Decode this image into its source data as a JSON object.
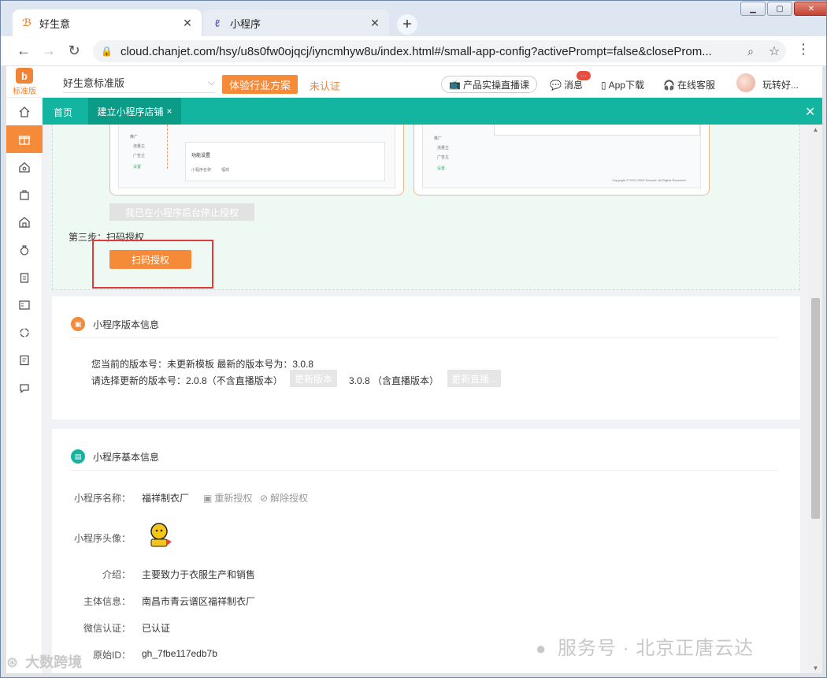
{
  "browser": {
    "tabs": [
      {
        "title": "好生意",
        "icon": "haoshengyi-logo-icon"
      },
      {
        "title": "小程序",
        "icon": "miniprogram-icon"
      }
    ],
    "url": "cloud.chanjet.com/hsy/u8s0fw0ojqcj/iyncmhyw8u/index.html#/small-app-config?activePrompt=false&closeProm...",
    "window_buttons": [
      "minimize",
      "maximize",
      "close"
    ]
  },
  "app": {
    "logo_edition": "标准版",
    "version_select": "好生意标准版",
    "plan_button": "体验行业方案",
    "unverified": "未认证",
    "live_course": "产品实操直播课",
    "messages": "消息",
    "message_badge": "···",
    "app_download": "App下载",
    "online_service": "在线客服",
    "username": "玩转好...",
    "tabs": {
      "home": "首页",
      "active": "建立小程序店铺",
      "active_close": "×"
    },
    "accent": "#13b4a0",
    "brand": "#f58a38"
  },
  "sidebar": {
    "items": [
      "home-icon",
      "gift-icon",
      "house-settings-icon",
      "bag-icon",
      "store-icon",
      "money-bag-icon",
      "clipboard-icon",
      "report-icon",
      "cycle-icon",
      "document-icon",
      "chat-icon"
    ]
  },
  "auth": {
    "stop_button": "我已在小程序后台停止授权",
    "step3_label": "第三步：扫码授权",
    "scan_button": "扫码授权",
    "mock_texts": {
      "menu_a": "推广",
      "menu_b": "流量主",
      "menu_c": "广告主",
      "menu_d": "设置",
      "section": "功能设置",
      "row": "小程序名称",
      "row2": "福祥",
      "footer": "Copyright © 2012-2020 Tencent. All Rights Reserved."
    }
  },
  "version_info": {
    "title": "小程序版本信息",
    "current": "您当前的版本号：未更新模板  最新的版本号为：3.0.8",
    "select_label": "请选择更新的版本号：2.0.8（不含直播版本）",
    "update_button": "更新版本",
    "option2": "3.0.8 （含直播版本）",
    "update_live_button": "更新直播..."
  },
  "basic_info": {
    "title": "小程序基本信息",
    "name_label": "小程序名称：",
    "name_value": "福祥制衣厂",
    "reauth": "重新授权",
    "unbind": "解除授权",
    "avatar_label": "小程序头像：",
    "intro_label": "介绍：",
    "intro_value": "主要致力于衣服生产和销售",
    "entity_label": "主体信息：",
    "entity_value": "南昌市青云谱区福祥制衣厂",
    "wechat_label": "微信认证：",
    "wechat_value": "已认证",
    "id_label": "原始ID：",
    "id_value": "gh_7fbe117edb7b"
  },
  "watermarks": {
    "right": "服务号 · 北京正唐云达",
    "left": "大数跨境"
  }
}
